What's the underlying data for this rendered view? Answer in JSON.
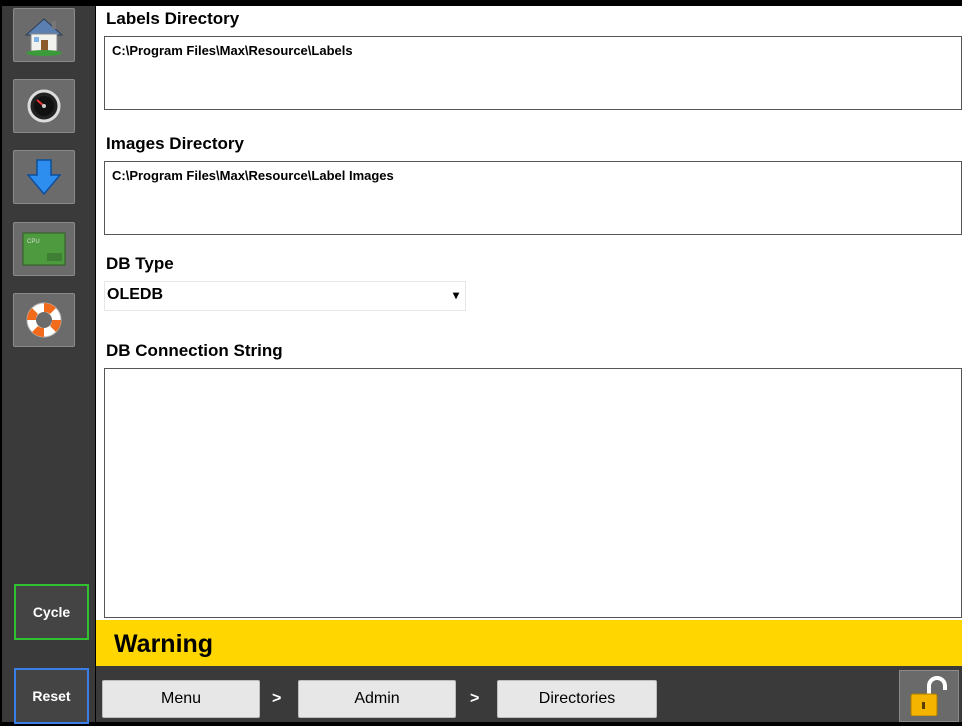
{
  "sidebar": {
    "icons": [
      {
        "name": "home-icon"
      },
      {
        "name": "gauge-icon"
      },
      {
        "name": "download-arrow-icon"
      },
      {
        "name": "cpu-chip-icon",
        "label": "CPU"
      },
      {
        "name": "lifebuoy-icon"
      }
    ],
    "cycle_label": "Cycle",
    "reset_label": "Reset"
  },
  "fields": {
    "labels_directory": {
      "label": "Labels Directory",
      "value": "C:\\Program Files\\Max\\Resource\\Labels"
    },
    "images_directory": {
      "label": "Images Directory",
      "value": "C:\\Program Files\\Max\\Resource\\Label Images"
    },
    "db_type": {
      "label": "DB Type",
      "value": "OLEDB"
    },
    "db_connection_string": {
      "label": "DB Connection String",
      "value": ""
    }
  },
  "warning": {
    "text": "Warning",
    "color": "#ffd600"
  },
  "breadcrumb": {
    "items": [
      "Menu",
      "Admin",
      "Directories"
    ],
    "separator": ">"
  },
  "colors": {
    "sidebar_bg": "#3a3a3a",
    "cycle_border": "#2fc12f",
    "reset_border": "#3a7ee8"
  }
}
